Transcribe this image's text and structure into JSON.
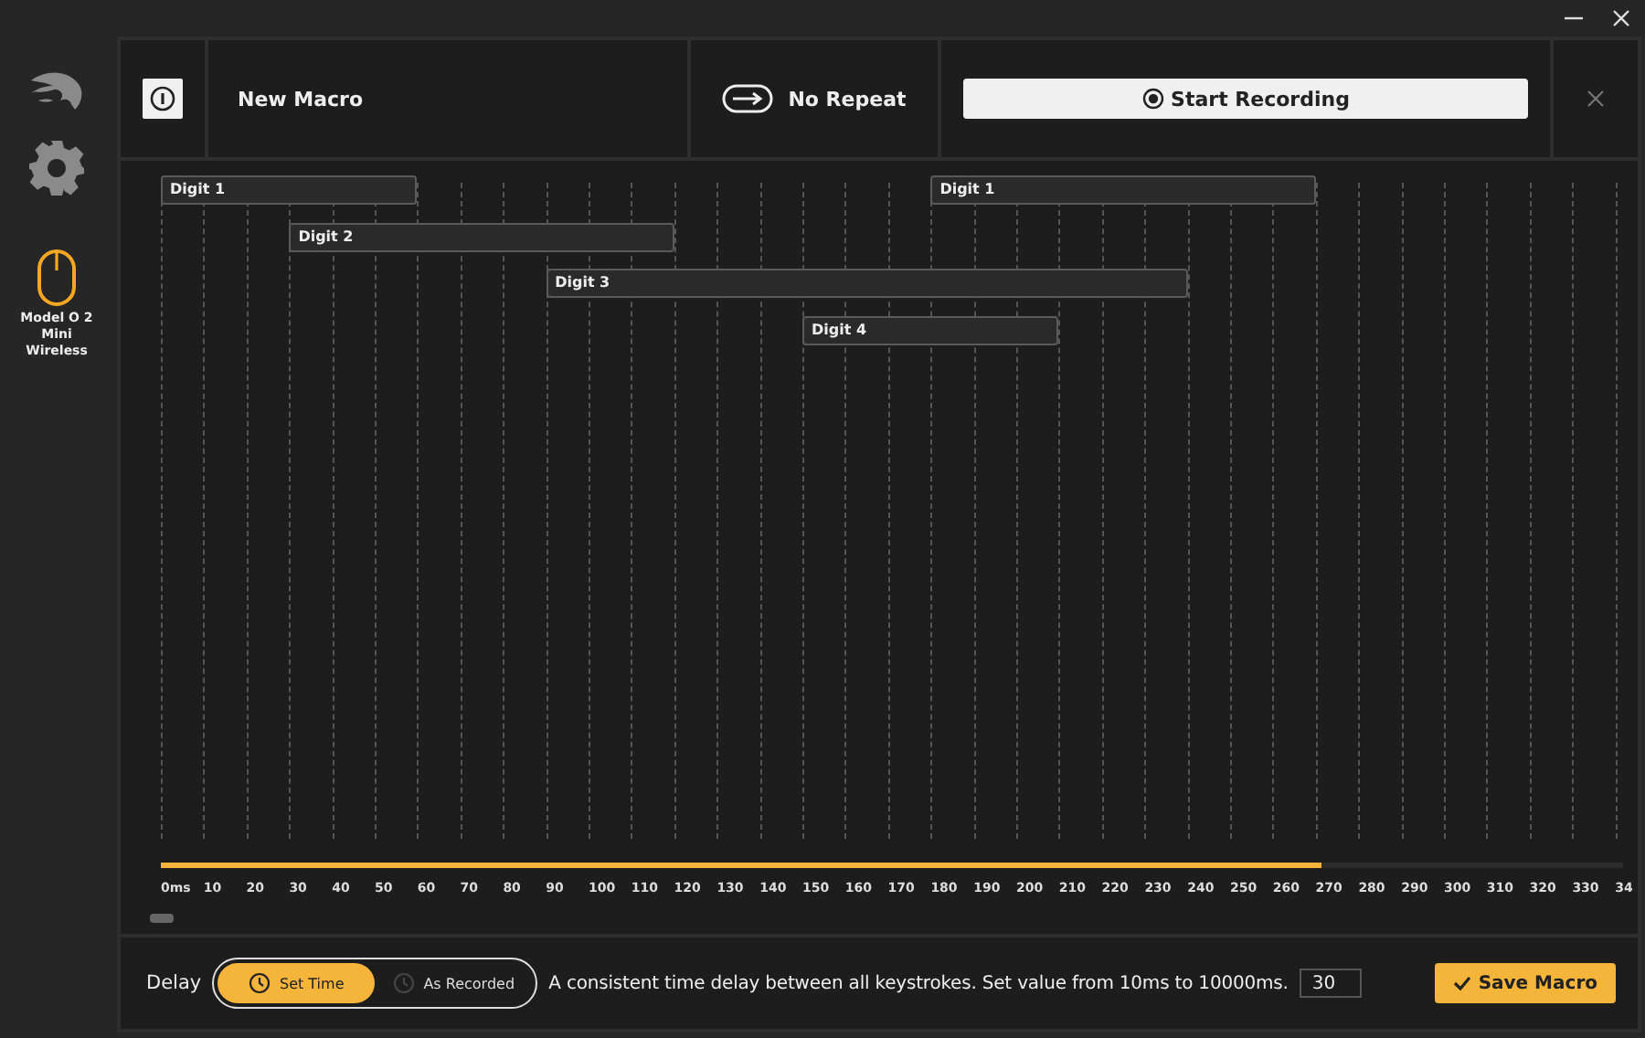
{
  "sidebar": {
    "device": {
      "name": "Model O 2 Mini Wireless",
      "selected": true
    }
  },
  "header": {
    "title": "New Macro",
    "repeat": "No Repeat",
    "record_button": "Start Recording"
  },
  "timeline": {
    "ticks": [
      "0ms",
      "10",
      "20",
      "30",
      "40",
      "50",
      "60",
      "70",
      "80",
      "90",
      "100",
      "110",
      "120",
      "130",
      "140",
      "150",
      "160",
      "170",
      "180",
      "190",
      "200",
      "210",
      "220",
      "230",
      "240",
      "250",
      "260",
      "270",
      "280",
      "290",
      "300",
      "310",
      "320",
      "330",
      "34"
    ],
    "events": [
      {
        "label": "Digit 1"
      },
      {
        "label": "Digit 2"
      },
      {
        "label": "Digit 3"
      },
      {
        "label": "Digit 4"
      },
      {
        "label": "Digit 1"
      }
    ],
    "level": 0.794
  },
  "footer": {
    "delay_label": "Delay",
    "options": [
      {
        "label": "Set Time",
        "selected": true
      },
      {
        "label": "As Recorded",
        "selected": false
      }
    ],
    "description": "A consistent time delay between all keystrokes. Set value from 10ms to 10000ms.",
    "value": "30",
    "save_button": "Save Macro"
  }
}
